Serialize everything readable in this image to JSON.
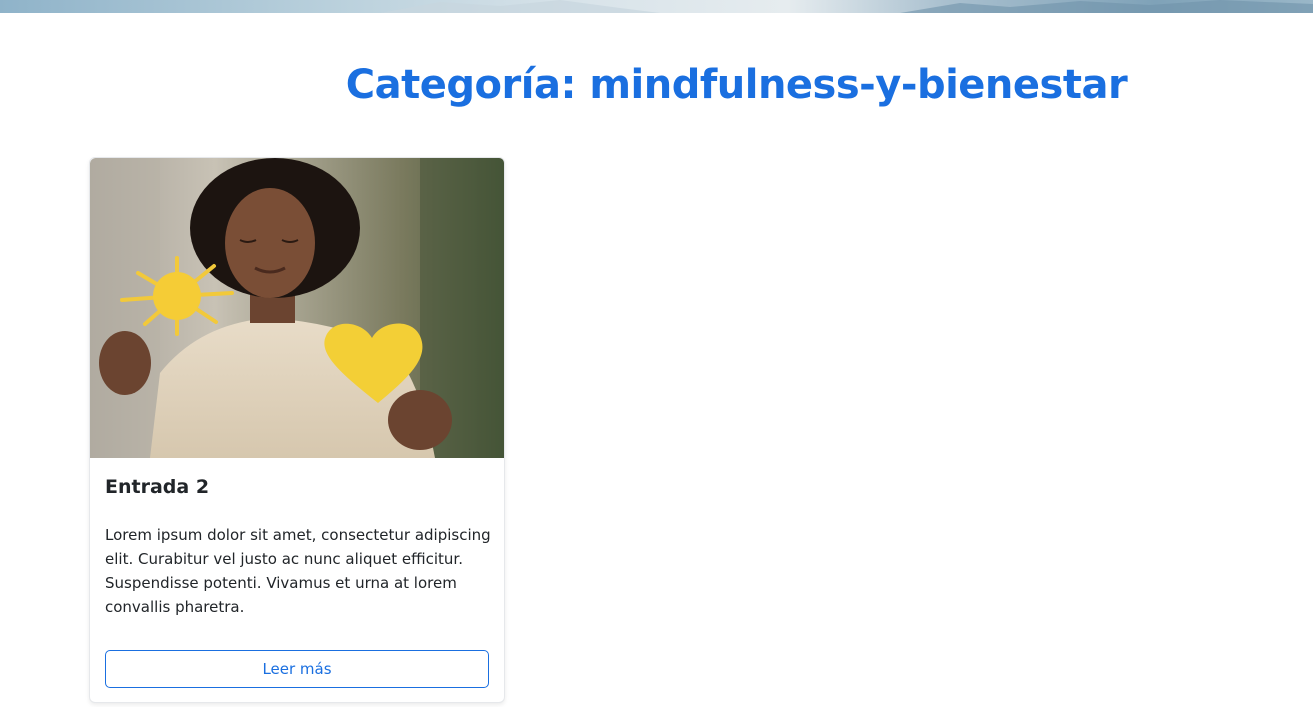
{
  "page": {
    "title": "Categoría: mindfulness-y-bienestar"
  },
  "posts": [
    {
      "title": "Entrada 2",
      "excerpt": "Lorem ipsum dolor sit amet, consectetur adipiscing elit. Curabitur vel justo ac nunc aliquet efficitur. Suspendisse potenti. Vivamus et urna at lorem convallis pharetra.",
      "button_label": "Leer más"
    }
  ],
  "colors": {
    "accent": "#1a6fe0",
    "text": "#212529"
  }
}
